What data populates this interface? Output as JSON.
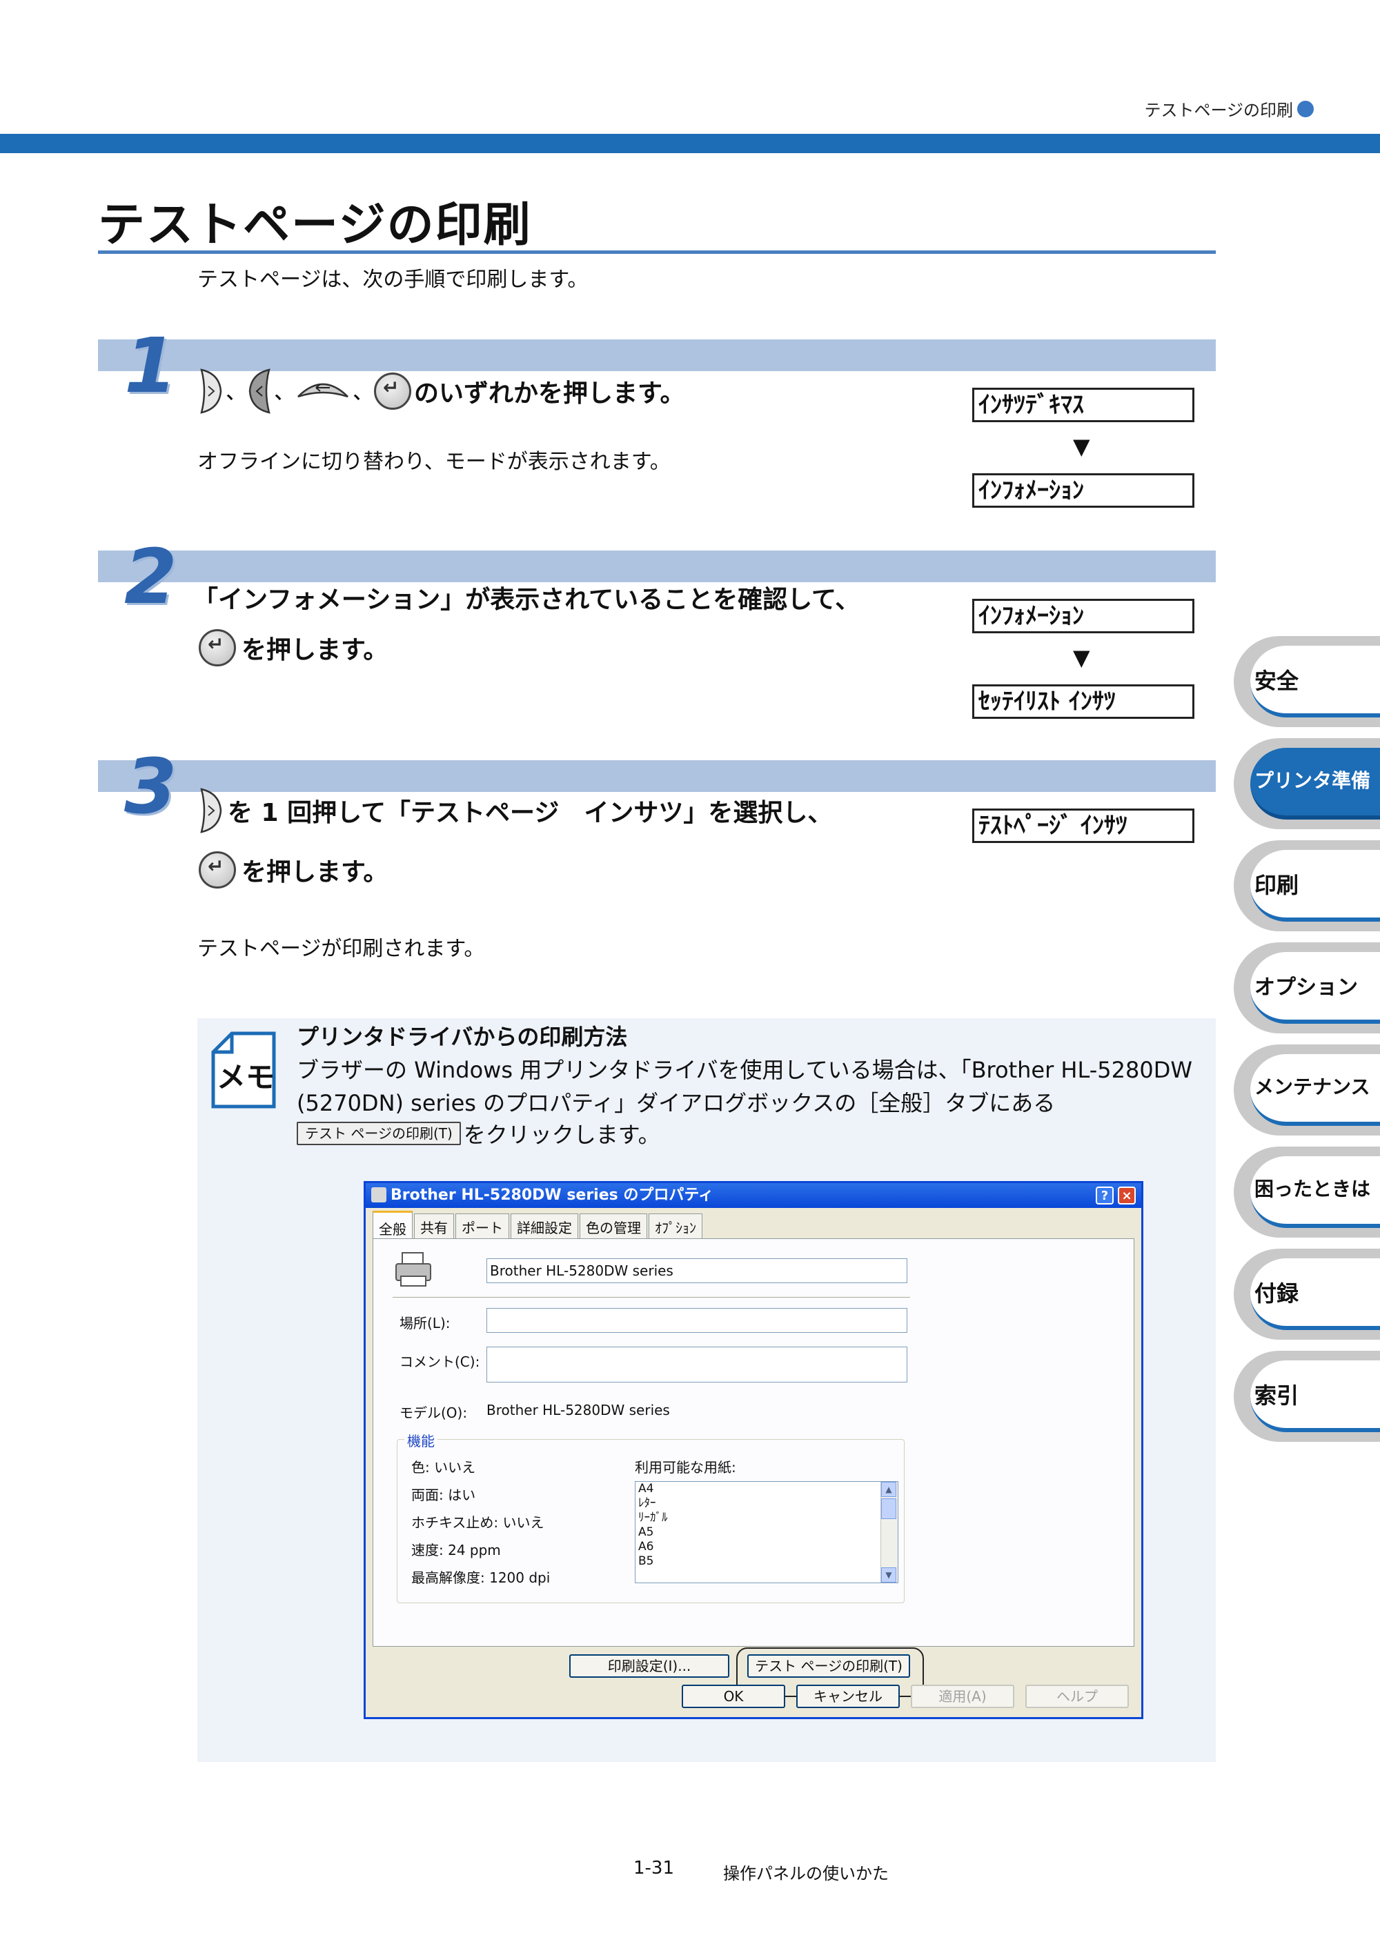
{
  "header": {
    "section_label": "テストページの印刷"
  },
  "page_title": "テストページの印刷",
  "intro": "テストページは、次の手順で印刷します。",
  "steps": [
    {
      "number": "1",
      "separator": "、",
      "heading": "のいずれかを押します。",
      "body": "オフラインに切り替わり、モードが表示されます。",
      "lcd": [
        "ｲﾝｻﾂﾃﾞｷﾏｽ",
        "ｲﾝﾌｫﾒｰｼｮﾝ"
      ]
    },
    {
      "number": "2",
      "heading_line1": "「インフォメーション」が表示されていることを確認して、",
      "heading_line2": "を押します。",
      "lcd": [
        "ｲﾝﾌｫﾒｰｼｮﾝ",
        "ｾｯﾃｲﾘｽﾄ ｲﾝｻﾂ"
      ]
    },
    {
      "number": "3",
      "heading_line1": "を 1 回押して「テストページ　インサツ」を選択し、",
      "heading_line2": "を押します。",
      "body": "テストページが印刷されます。",
      "lcd": [
        "ﾃｽﾄﾍﾟｰｼﾞ ｲﾝｻﾂ"
      ]
    }
  ],
  "arrow_glyph": "▼",
  "memo": {
    "icon_text": "メモ",
    "title": "プリンタドライバからの印刷方法",
    "line1": "ブラザーの Windows 用プリンタドライバを使用している場合は、「Brother HL-5280DW",
    "line2": "(5270DN) series のプロパティ」ダイアログボックスの［全般］タブにある",
    "button_label": "テスト ページの印刷(T)",
    "line3": "をクリックします。"
  },
  "dialog": {
    "title": "Brother HL-5280DW series のプロパティ",
    "help_btn": "?",
    "close_btn": "×",
    "tabs": [
      "全般",
      "共有",
      "ポート",
      "詳細設定",
      "色の管理",
      "ｵﾌﾟｼｮﾝ"
    ],
    "printer_name": "Brother HL-5280DW series",
    "location_label": "場所(L):",
    "comment_label": "コメント(C):",
    "model_label": "モデル(O):",
    "model_value": "Brother HL-5280DW series",
    "features_legend": "機能",
    "features": [
      "色: いいえ",
      "両面: はい",
      "ホチキス止め: いいえ",
      "速度: 24 ppm",
      "最高解像度: 1200 dpi"
    ],
    "paper_label": "利用可能な用紙:",
    "papers": [
      "A4",
      "ﾚﾀｰ",
      "ﾘｰｶﾞﾙ",
      "A5",
      "A6",
      "B5"
    ],
    "print_settings_btn": "印刷設定(I)...",
    "test_page_btn": "テスト ページの印刷(T)",
    "ok_btn": "OK",
    "cancel_btn": "キャンセル",
    "apply_btn": "適用(A)",
    "help_text_btn": "ヘルプ"
  },
  "side_tabs": [
    "安全",
    "プリンタ準備",
    "印刷",
    "オプション",
    "メンテナンス",
    "困ったときは",
    "付録",
    "索引"
  ],
  "footer": {
    "page_number": "1-31",
    "chapter": "操作パネルの使いかた"
  }
}
